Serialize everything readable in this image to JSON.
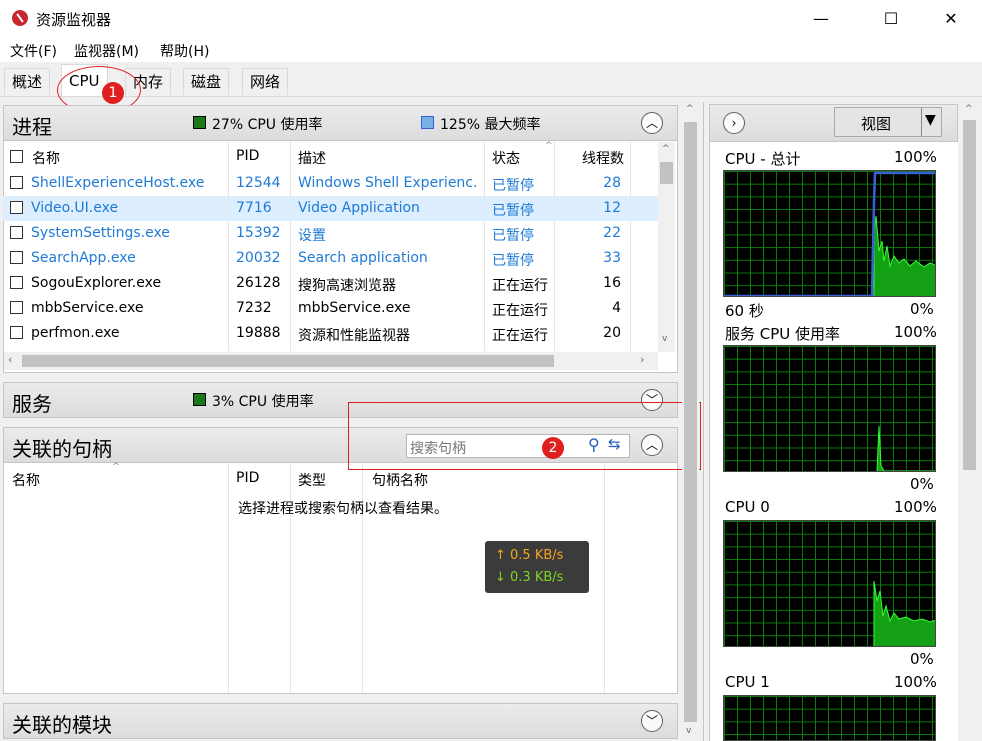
{
  "window": {
    "title": "资源监视器",
    "minimize": "—",
    "maximize": "☐",
    "close": "✕"
  },
  "menu": [
    "文件(F)",
    "监视器(M)",
    "帮助(H)"
  ],
  "tabs": [
    "概述",
    "CPU",
    "内存",
    "磁盘",
    "网络"
  ],
  "annotations": {
    "marker1": "1",
    "marker2": "2"
  },
  "processes": {
    "title": "进程",
    "cpu_usage": "27% CPU 使用率",
    "max_freq": "125% 最大频率",
    "columns": [
      "名称",
      "PID",
      "描述",
      "状态",
      "线程数"
    ],
    "rows": [
      {
        "name": "ShellExperienceHost.exe",
        "pid": "12544",
        "desc": "Windows Shell Experienc...",
        "status": "已暂停",
        "threads": "28",
        "suspended": true
      },
      {
        "name": "Video.UI.exe",
        "pid": "7716",
        "desc": "Video Application",
        "status": "已暂停",
        "threads": "12",
        "suspended": true
      },
      {
        "name": "SystemSettings.exe",
        "pid": "15392",
        "desc": "设置",
        "status": "已暂停",
        "threads": "22",
        "suspended": true
      },
      {
        "name": "SearchApp.exe",
        "pid": "20032",
        "desc": "Search application",
        "status": "已暂停",
        "threads": "33",
        "suspended": true
      },
      {
        "name": "SogouExplorer.exe",
        "pid": "26128",
        "desc": "搜狗高速浏览器",
        "status": "正在运行",
        "threads": "16",
        "suspended": false
      },
      {
        "name": "mbbService.exe",
        "pid": "7232",
        "desc": "mbbService.exe",
        "status": "正在运行",
        "threads": "4",
        "suspended": false
      },
      {
        "name": "perfmon.exe",
        "pid": "19888",
        "desc": "资源和性能监视器",
        "status": "正在运行",
        "threads": "20",
        "suspended": false
      }
    ]
  },
  "services": {
    "title": "服务",
    "cpu_usage": "3% CPU 使用率"
  },
  "handles": {
    "title": "关联的句柄",
    "search_placeholder": "搜索句柄",
    "columns": [
      "名称",
      "PID",
      "类型",
      "句柄名称"
    ],
    "empty_message": "选择进程或搜索句柄以查看结果。"
  },
  "modules": {
    "title": "关联的模块"
  },
  "network_tooltip": {
    "up": "↑ 0.5 KB/s",
    "down": "↓ 0.3 KB/s"
  },
  "right_panel": {
    "view_label": "视图",
    "graphs": [
      {
        "title": "CPU - 总计",
        "max": "100%",
        "time": "60 秒",
        "min": "0%"
      },
      {
        "title": "服务 CPU 使用率",
        "max": "100%",
        "min": "0%"
      },
      {
        "title": "CPU 0",
        "max": "100%",
        "min": "0%"
      },
      {
        "title": "CPU 1",
        "max": "100%"
      }
    ]
  },
  "colors": {
    "link_blue": "#1e7ad6",
    "graph_green": "#22ee22",
    "freq_blue": "#3a5fd8",
    "annotation_red": "#e02020"
  }
}
